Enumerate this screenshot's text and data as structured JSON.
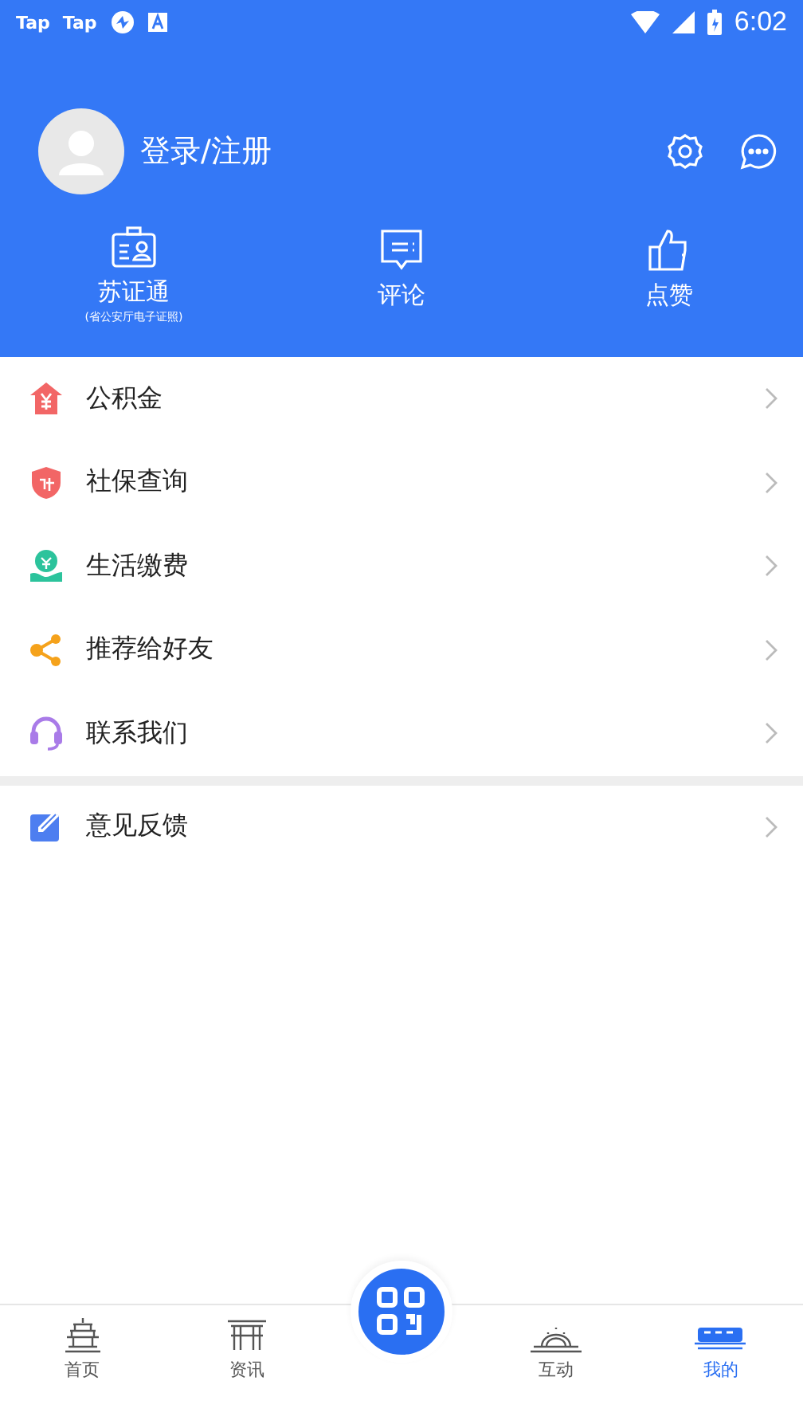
{
  "status_bar": {
    "apps": [
      "Tap",
      "Tap"
    ],
    "time": "6:02"
  },
  "profile": {
    "login_label": "登录/注册"
  },
  "quick_actions": [
    {
      "kind": "id",
      "label": "苏证通",
      "sublabel": "(省公安厅电子证照)"
    },
    {
      "kind": "comment",
      "label": "评论"
    },
    {
      "kind": "like",
      "label": "点赞"
    }
  ],
  "menu_groups": [
    [
      {
        "kind": "fund",
        "label": "公积金",
        "color": "#f26666"
      },
      {
        "kind": "insurance",
        "label": "社保查询",
        "color": "#f26666"
      },
      {
        "kind": "payment",
        "label": "生活缴费",
        "color": "#2cc39c"
      },
      {
        "kind": "share",
        "label": "推荐给好友",
        "color": "#f5a21b"
      },
      {
        "kind": "support",
        "label": "联系我们",
        "color": "#a97be8"
      }
    ],
    [
      {
        "kind": "feedback",
        "label": "意见反馈",
        "color": "#4d7ef0"
      }
    ]
  ],
  "bottom_nav": [
    {
      "kind": "home",
      "label": "首页",
      "selected": false
    },
    {
      "kind": "news",
      "label": "资讯",
      "selected": false
    },
    {
      "kind": "scan",
      "selected": false
    },
    {
      "kind": "interact",
      "label": "互动",
      "selected": false
    },
    {
      "kind": "mine",
      "label": "我的",
      "selected": true
    }
  ]
}
